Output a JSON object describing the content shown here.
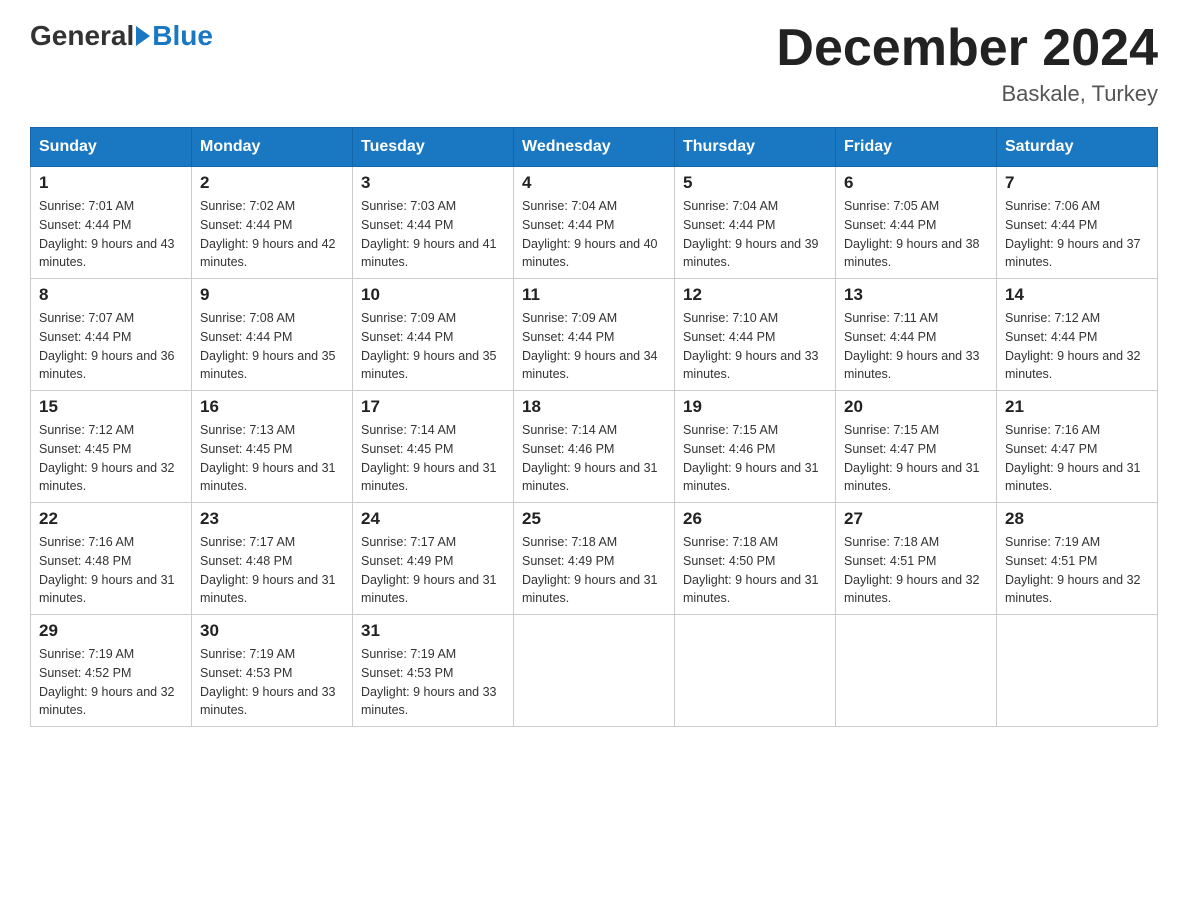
{
  "header": {
    "logo_general": "General",
    "logo_blue": "Blue",
    "month_title": "December 2024",
    "location": "Baskale, Turkey"
  },
  "days_of_week": [
    "Sunday",
    "Monday",
    "Tuesday",
    "Wednesday",
    "Thursday",
    "Friday",
    "Saturday"
  ],
  "weeks": [
    [
      {
        "day": "1",
        "sunrise": "7:01 AM",
        "sunset": "4:44 PM",
        "daylight": "9 hours and 43 minutes."
      },
      {
        "day": "2",
        "sunrise": "7:02 AM",
        "sunset": "4:44 PM",
        "daylight": "9 hours and 42 minutes."
      },
      {
        "day": "3",
        "sunrise": "7:03 AM",
        "sunset": "4:44 PM",
        "daylight": "9 hours and 41 minutes."
      },
      {
        "day": "4",
        "sunrise": "7:04 AM",
        "sunset": "4:44 PM",
        "daylight": "9 hours and 40 minutes."
      },
      {
        "day": "5",
        "sunrise": "7:04 AM",
        "sunset": "4:44 PM",
        "daylight": "9 hours and 39 minutes."
      },
      {
        "day": "6",
        "sunrise": "7:05 AM",
        "sunset": "4:44 PM",
        "daylight": "9 hours and 38 minutes."
      },
      {
        "day": "7",
        "sunrise": "7:06 AM",
        "sunset": "4:44 PM",
        "daylight": "9 hours and 37 minutes."
      }
    ],
    [
      {
        "day": "8",
        "sunrise": "7:07 AM",
        "sunset": "4:44 PM",
        "daylight": "9 hours and 36 minutes."
      },
      {
        "day": "9",
        "sunrise": "7:08 AM",
        "sunset": "4:44 PM",
        "daylight": "9 hours and 35 minutes."
      },
      {
        "day": "10",
        "sunrise": "7:09 AM",
        "sunset": "4:44 PM",
        "daylight": "9 hours and 35 minutes."
      },
      {
        "day": "11",
        "sunrise": "7:09 AM",
        "sunset": "4:44 PM",
        "daylight": "9 hours and 34 minutes."
      },
      {
        "day": "12",
        "sunrise": "7:10 AM",
        "sunset": "4:44 PM",
        "daylight": "9 hours and 33 minutes."
      },
      {
        "day": "13",
        "sunrise": "7:11 AM",
        "sunset": "4:44 PM",
        "daylight": "9 hours and 33 minutes."
      },
      {
        "day": "14",
        "sunrise": "7:12 AM",
        "sunset": "4:44 PM",
        "daylight": "9 hours and 32 minutes."
      }
    ],
    [
      {
        "day": "15",
        "sunrise": "7:12 AM",
        "sunset": "4:45 PM",
        "daylight": "9 hours and 32 minutes."
      },
      {
        "day": "16",
        "sunrise": "7:13 AM",
        "sunset": "4:45 PM",
        "daylight": "9 hours and 31 minutes."
      },
      {
        "day": "17",
        "sunrise": "7:14 AM",
        "sunset": "4:45 PM",
        "daylight": "9 hours and 31 minutes."
      },
      {
        "day": "18",
        "sunrise": "7:14 AM",
        "sunset": "4:46 PM",
        "daylight": "9 hours and 31 minutes."
      },
      {
        "day": "19",
        "sunrise": "7:15 AM",
        "sunset": "4:46 PM",
        "daylight": "9 hours and 31 minutes."
      },
      {
        "day": "20",
        "sunrise": "7:15 AM",
        "sunset": "4:47 PM",
        "daylight": "9 hours and 31 minutes."
      },
      {
        "day": "21",
        "sunrise": "7:16 AM",
        "sunset": "4:47 PM",
        "daylight": "9 hours and 31 minutes."
      }
    ],
    [
      {
        "day": "22",
        "sunrise": "7:16 AM",
        "sunset": "4:48 PM",
        "daylight": "9 hours and 31 minutes."
      },
      {
        "day": "23",
        "sunrise": "7:17 AM",
        "sunset": "4:48 PM",
        "daylight": "9 hours and 31 minutes."
      },
      {
        "day": "24",
        "sunrise": "7:17 AM",
        "sunset": "4:49 PM",
        "daylight": "9 hours and 31 minutes."
      },
      {
        "day": "25",
        "sunrise": "7:18 AM",
        "sunset": "4:49 PM",
        "daylight": "9 hours and 31 minutes."
      },
      {
        "day": "26",
        "sunrise": "7:18 AM",
        "sunset": "4:50 PM",
        "daylight": "9 hours and 31 minutes."
      },
      {
        "day": "27",
        "sunrise": "7:18 AM",
        "sunset": "4:51 PM",
        "daylight": "9 hours and 32 minutes."
      },
      {
        "day": "28",
        "sunrise": "7:19 AM",
        "sunset": "4:51 PM",
        "daylight": "9 hours and 32 minutes."
      }
    ],
    [
      {
        "day": "29",
        "sunrise": "7:19 AM",
        "sunset": "4:52 PM",
        "daylight": "9 hours and 32 minutes."
      },
      {
        "day": "30",
        "sunrise": "7:19 AM",
        "sunset": "4:53 PM",
        "daylight": "9 hours and 33 minutes."
      },
      {
        "day": "31",
        "sunrise": "7:19 AM",
        "sunset": "4:53 PM",
        "daylight": "9 hours and 33 minutes."
      },
      null,
      null,
      null,
      null
    ]
  ]
}
